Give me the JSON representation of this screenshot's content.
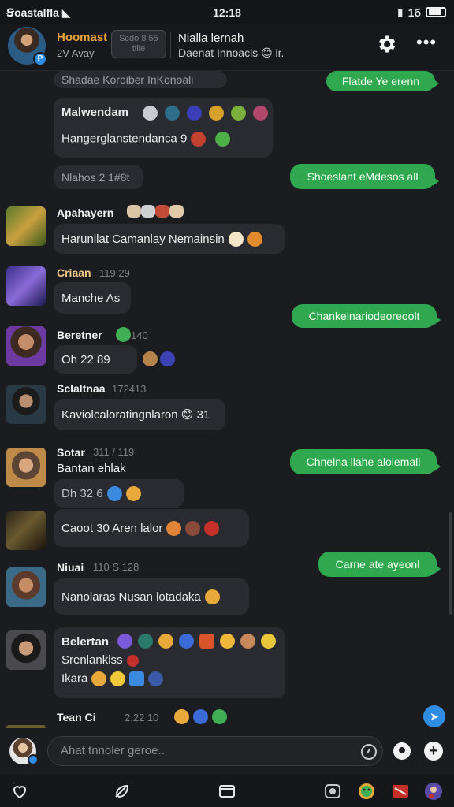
{
  "status": {
    "carrier": "Ꞩoastalfla",
    "time": "12:18",
    "right": "1б"
  },
  "header": {
    "name": "Hoomast",
    "sub": "2V Avay",
    "pill_line1": "Scdo 8 55",
    "pill_line2": "tllle",
    "title": "Nialla lernah",
    "title2": "Daenat Innoacls 😊 ir."
  },
  "messages": {
    "top_partial": "Shadae Koroiber InKonoali",
    "sent1": "Flatde Ye erenn",
    "m1_name": "Malwendam",
    "m1_text": "Hangerglanstendanca 9",
    "sent2": "Shoeslant eMdesos all",
    "sys1": "Nlahos 2 1#8t",
    "m2_name": "Apahayern",
    "m2_text": "Harunilat Camanlay Nemainsin",
    "m3_name": "Criaan",
    "m3_ts": "119:29",
    "m3_text": "Manche As",
    "sent3": "Chankelnariodeoreoolt",
    "m4_name": "Beretner",
    "m4_ts": "140",
    "m4_text": "Oh    22    89",
    "m5_name": "Sclaltnaa",
    "m5_ts": "172413",
    "m5_text": "Kaviolcaloratingnlaron 😊 31",
    "m6_name": "Sotar",
    "m6_ts": "311 / 119",
    "sent4": "Chnelna llahe alolemall",
    "m6_text": "Bantan ehlak",
    "m6_text2": "Dh   32      6",
    "m7_text": "Caoot 30 Aren lalor",
    "m8_name": "Niuai",
    "m8_ts": "110 S 128",
    "sent5": "Carne ate ayeonl",
    "m8_text": "Nanolaras Nusan lotadaka",
    "m9_name": "Belertan",
    "m9_text1": "Srenlanklss",
    "m9_text2": "Ikara",
    "m10_name": "Tean Ci",
    "m10_ts": "2:22      10"
  },
  "composer": {
    "placeholder": "Ahat tnnoler geroe.."
  },
  "icons": {
    "nav": [
      "heart-icon",
      "feather-icon",
      "window-icon",
      "camera-icon",
      "smiley-icon",
      "flag-icon",
      "avatar-icon"
    ]
  },
  "colors": {
    "sent_bubble": "#2fa84f",
    "received_bubble": "#2a2b30",
    "accent_name": "#f0a53a",
    "badge": "#2f8de4"
  }
}
